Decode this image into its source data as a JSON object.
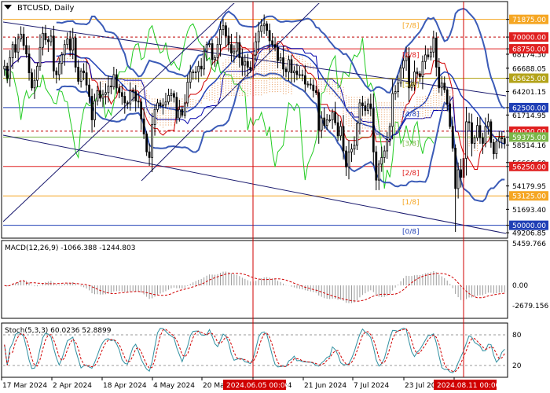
{
  "chart_data": {
    "type": "candlestick",
    "title": "BTCUSD, Daily",
    "symbol": "BTCUSD",
    "timeframe": "Daily",
    "x_ticks": [
      "17 Mar 2024",
      "2 Apr 2024",
      "18 Apr 2024",
      "4 May 2024",
      "20 May 2024",
      "5 Jun 2024",
      "21 Jun 2024",
      "7 Jul 2024",
      "23 Jul 2024",
      "8 Aug 2024"
    ],
    "x_markers": [
      "2024.06.05 00:00",
      "2024.08.11 00:00"
    ],
    "price_axis": {
      "ticks": [
        "71875.00",
        "70000.00",
        "68174.30",
        "68750.00",
        "66688.05",
        "65625.00",
        "64201.15",
        "62500.00",
        "61714.95",
        "60000.00",
        "59375.00",
        "58514.16",
        "56666.60",
        "56250.00",
        "54179.95",
        "53125.00",
        "51693.40",
        "50000.00",
        "49206.85"
      ],
      "ylim": [
        48800,
        73600
      ],
      "current_price": 58514.16
    },
    "murrey_levels": [
      {
        "label": "[7/8]",
        "value": 71875,
        "color": "#f5a623"
      },
      {
        "label": "[6/8]",
        "value": 68750,
        "color": "#e02020"
      },
      {
        "label": "[5/8]",
        "value": 65625,
        "color": "#b3a31a"
      },
      {
        "label": "[4/8]",
        "value": 62500,
        "color": "#1f3fb5"
      },
      {
        "label": "[3/8]",
        "value": 59375,
        "color": "#7ab648"
      },
      {
        "label": "[2/8]",
        "value": 56250,
        "color": "#e02020"
      },
      {
        "label": "[1/8]",
        "value": 53125,
        "color": "#f5a623"
      },
      {
        "label": "[0/8]",
        "value": 50000,
        "color": "#1f3fb5"
      }
    ],
    "highlighted_prices": [
      {
        "value": 71875,
        "text": "71875.00",
        "bg": "#f5a623"
      },
      {
        "value": 70000,
        "text": "70000.00",
        "bg": "#e02020"
      },
      {
        "value": 68750,
        "text": "68750.00",
        "bg": "#e02020"
      },
      {
        "value": 65625,
        "text": "65625.00",
        "bg": "#b3a31a"
      },
      {
        "value": 62500,
        "text": "62500.00",
        "bg": "#1f3fb5"
      },
      {
        "value": 60000,
        "text": "60000.00",
        "bg": "#e02020"
      },
      {
        "value": 59375,
        "text": "59375.00",
        "bg": "#7ab648"
      },
      {
        "value": 58514.16,
        "text": "58514.16",
        "bg": "#ffffff"
      },
      {
        "value": 56250,
        "text": "56250.00",
        "bg": "#e02020"
      },
      {
        "value": 53125,
        "text": "53125.00",
        "bg": "#f5a623"
      },
      {
        "value": 50000,
        "text": "50000.00",
        "bg": "#1f3fb5"
      }
    ],
    "dashed_levels": [
      70000,
      60000
    ],
    "close_prices": [
      66900,
      65600,
      67800,
      69200,
      68400,
      69800,
      70300,
      69100,
      68200,
      66200,
      64600,
      65400,
      66900,
      68900,
      70400,
      69700,
      69500,
      70100,
      66400,
      66000,
      67200,
      68100,
      69200,
      69800,
      68600,
      69900,
      66800,
      65300,
      66400,
      66200,
      64900,
      63700,
      61200,
      63200,
      64300,
      63500,
      63900,
      64100,
      64800,
      64700,
      66000,
      64600,
      64100,
      63700,
      63000,
      62900,
      64300,
      64200,
      63200,
      63100,
      61300,
      59700,
      57800,
      57200,
      60700,
      62300,
      63000,
      62700,
      62800,
      63100,
      63800,
      64000,
      63600,
      61400,
      62300,
      61700,
      63000,
      65200,
      66300,
      66300,
      66300,
      66900,
      66600,
      68500,
      69200,
      69300,
      67600,
      67800,
      69200,
      70800,
      71200,
      70100,
      69200,
      68300,
      68500,
      69400,
      67800,
      67000,
      67400,
      66800,
      66500,
      68100,
      69500,
      70600,
      71200,
      71400,
      70700,
      69600,
      69200,
      68900,
      67500,
      67800,
      66600,
      66300,
      67600,
      66200,
      66400,
      66000,
      66000,
      65900,
      65000,
      65000,
      64900,
      64300,
      64100,
      60100,
      61400,
      60600,
      61200,
      61200,
      62000,
      60900,
      59500,
      60500,
      57900,
      56200,
      57800,
      58100,
      58500,
      60800,
      63000,
      62700,
      62200,
      62900,
      62400,
      57800,
      54800,
      56500,
      57200,
      57900,
      59100,
      60500,
      64000,
      64200,
      65100,
      66700,
      67500,
      68000,
      64600,
      64900,
      66300,
      66100,
      65800,
      67400,
      68100,
      67900,
      68400,
      69900,
      66800,
      64600,
      65100,
      64400,
      62900,
      60500,
      58200,
      53900,
      55900,
      55100,
      57100,
      61000,
      60900,
      58700,
      59300,
      60600,
      59300,
      58700,
      60500,
      61000,
      58800,
      57600,
      58900,
      59300,
      59200,
      58700
    ],
    "indicators": {
      "macd": {
        "label": "MACD(12,26,9) -1066.388 -1244.803",
        "params": "12,26,9",
        "main": -1066.388,
        "signal": -1244.803,
        "ticks": [
          "5459.766",
          "0.00",
          "-2679.156"
        ]
      },
      "stochastic": {
        "label": "Stoch(5,3,3) 60.0236 52.8899",
        "params": "5,3,3",
        "main": 60.0236,
        "signal": 52.8899,
        "levels": [
          "80",
          "20"
        ]
      }
    }
  }
}
